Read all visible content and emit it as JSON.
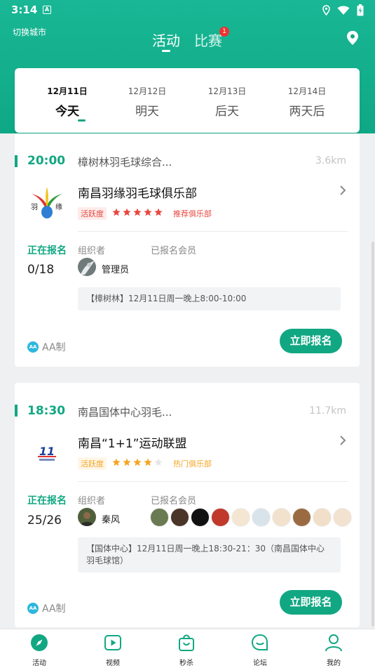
{
  "status_bar": {
    "time": "3:14",
    "badge": "A"
  },
  "header": {
    "city_label": "切换城市",
    "tabs": [
      {
        "label": "活动"
      },
      {
        "label": "比赛",
        "badge": "1"
      }
    ],
    "location_icon": "location-pin-icon"
  },
  "dates": [
    {
      "date": "12月11日",
      "weekday": "今天",
      "selected": true
    },
    {
      "date": "12月12日",
      "weekday": "明天"
    },
    {
      "date": "12月13日",
      "weekday": "后天"
    },
    {
      "date": "12月14日",
      "weekday": "两天后"
    }
  ],
  "activities": [
    {
      "time": "20:00",
      "venue": "樟树林羽毛球综合...",
      "distance": "3.6km",
      "club": "南昌羽缘羽毛球俱乐部",
      "logo_text": {
        "left": "羽",
        "right": "缘"
      },
      "activity_tag": "活跃度",
      "rating": 5,
      "recommend": "推荐俱乐部",
      "status": "正在报名",
      "count": "0/18",
      "organizer_label": "组织者",
      "organizer_name": "管理员",
      "members_label": "已报名会员",
      "note": "【樟树林】12月11日周一晚上8:00-10:00",
      "payment": "AA制",
      "payment_icon": "AA",
      "signup": "立即报名"
    },
    {
      "time": "18:30",
      "venue": "南昌国体中心羽毛...",
      "distance": "11.7km",
      "club": "南昌“1+1”运动联盟",
      "logo_text": {
        "main": "11"
      },
      "activity_tag": "活跃度",
      "rating": 4,
      "recommend": "热门俱乐部",
      "status": "正在报名",
      "count": "25/26",
      "organizer_label": "组织者",
      "organizer_name": "秦风",
      "members_label": "已报名会员",
      "note": "【国体中心】12月11日周一晚上18:30-21：30（南昌国体中心羽毛球馆）",
      "payment": "AA制",
      "payment_icon": "AA",
      "signup": "立即报名",
      "member_avatars": [
        "#6a7a52",
        "#4a3528",
        "#111111",
        "#c0392b",
        "#f5e6d3",
        "#d9e4ea",
        "#f2e1cc",
        "#9a6b42",
        "#f1dfc9",
        "#f3e2cf"
      ]
    }
  ],
  "bottom_nav": [
    {
      "label": "活动",
      "icon": "compass-icon",
      "active": true
    },
    {
      "label": "视频",
      "icon": "play-icon"
    },
    {
      "label": "秒杀",
      "icon": "shopping-bag-icon"
    },
    {
      "label": "论坛",
      "icon": "chat-bubble-icon"
    },
    {
      "label": "我的",
      "icon": "person-icon"
    }
  ],
  "colors": {
    "brand": "#12a783",
    "header_top": "#19b795",
    "tag_red": "#e8473f",
    "tag_orange": "#f5a623"
  }
}
